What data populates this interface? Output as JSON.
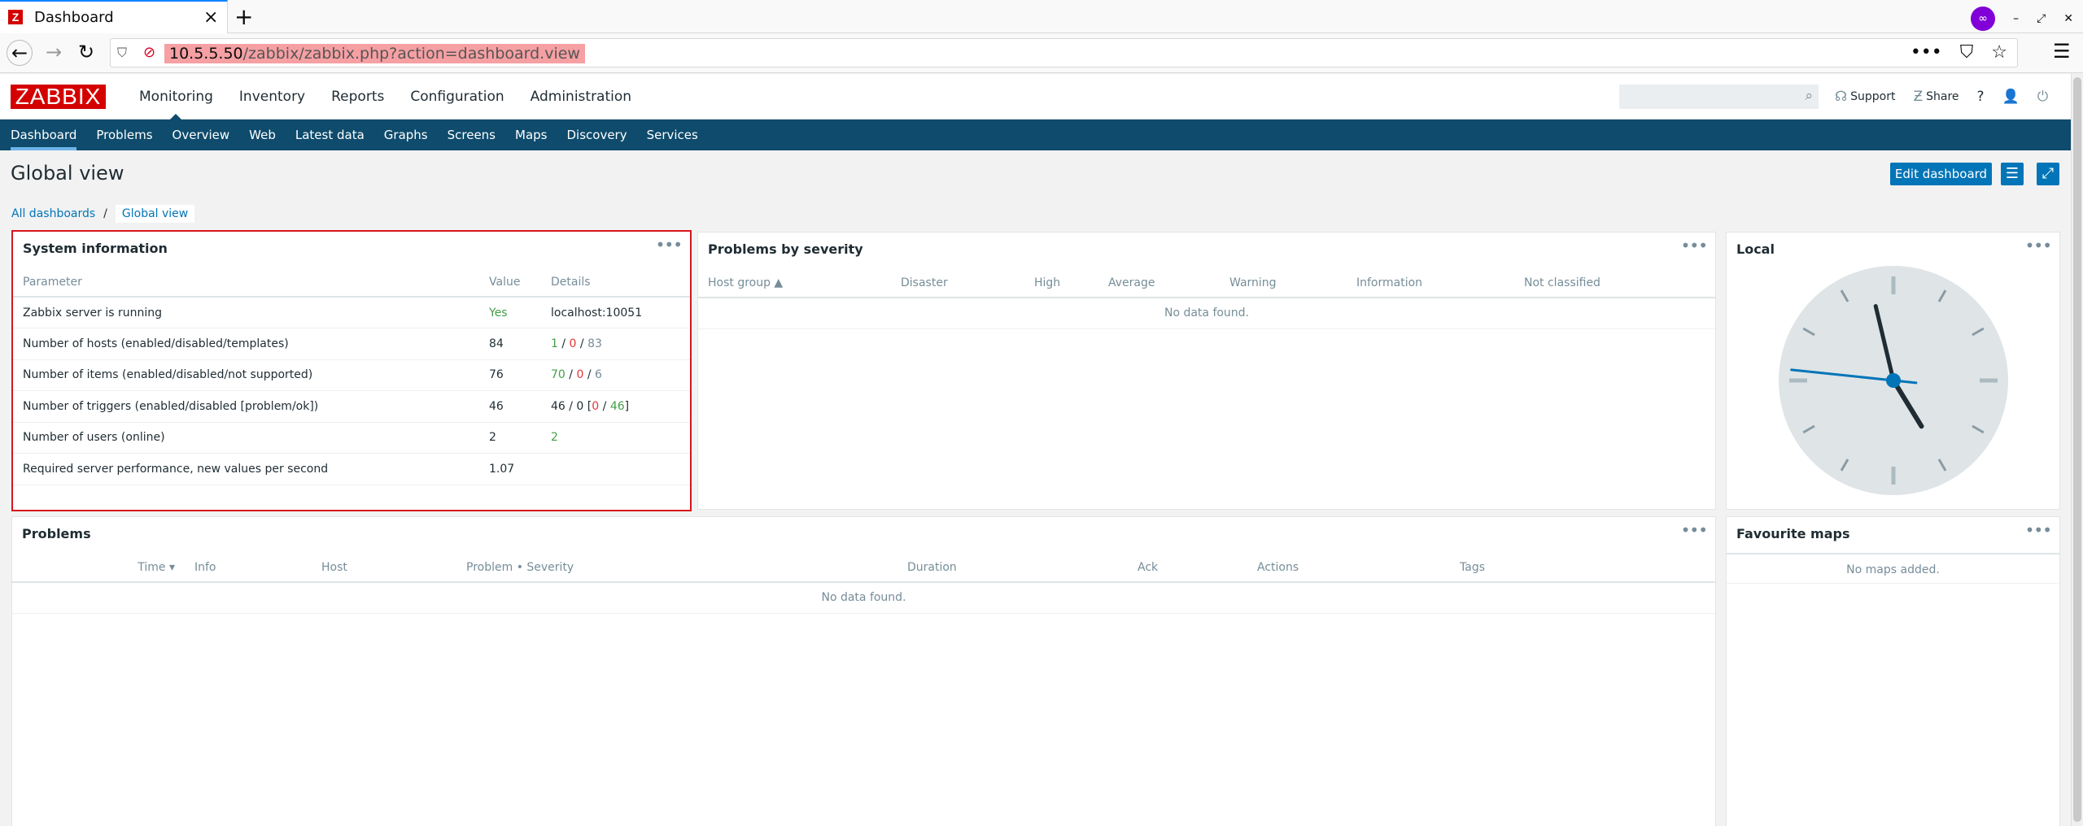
{
  "browser": {
    "tab_title": "Dashboard",
    "tab_favicon": "Z",
    "url_host": "10.5.5.50",
    "url_path": "/zabbix/zabbix.php?action=dashboard.view"
  },
  "header": {
    "logo": "ZABBIX",
    "menu": [
      "Monitoring",
      "Inventory",
      "Reports",
      "Configuration",
      "Administration"
    ],
    "search_placeholder": "",
    "support_label": "Support",
    "share_label": "Share",
    "help_label": "?"
  },
  "submenu": [
    "Dashboard",
    "Problems",
    "Overview",
    "Web",
    "Latest data",
    "Graphs",
    "Screens",
    "Maps",
    "Discovery",
    "Services"
  ],
  "page": {
    "title": "Global view",
    "edit_button": "Edit dashboard",
    "breadcrumb_root": "All dashboards",
    "breadcrumb_sep": "/",
    "breadcrumb_current": "Global view"
  },
  "system_info": {
    "title": "System information",
    "headers": [
      "Parameter",
      "Value",
      "Details"
    ],
    "rows": [
      {
        "param": "Zabbix server is running",
        "value": "Yes",
        "d1": "localhost:10051",
        "d2": "",
        "d3": "",
        "d4": "",
        "d5": "",
        "d6": "",
        "d7": ""
      },
      {
        "param": "Number of hosts (enabled/disabled/templates)",
        "value": "84",
        "d1": "1",
        "d2": " / ",
        "d3": "0",
        "d4": " / ",
        "d5": "83",
        "d6": "",
        "d7": ""
      },
      {
        "param": "Number of items (enabled/disabled/not supported)",
        "value": "76",
        "d1": "70",
        "d2": " / ",
        "d3": "0",
        "d4": " / ",
        "d5": "6",
        "d6": "",
        "d7": ""
      },
      {
        "param": "Number of triggers (enabled/disabled [problem/ok])",
        "value": "46",
        "d1": "46 / 0 [",
        "d2": "",
        "d3": "0",
        "d4": " / ",
        "d5": "46",
        "d6": "]",
        "d7": ""
      },
      {
        "param": "Number of users (online)",
        "value": "2",
        "d1": "",
        "d2": "",
        "d3": "",
        "d4": "",
        "d5": "2",
        "d6": "",
        "d7": ""
      },
      {
        "param": "Required server performance, new values per second",
        "value": "1.07",
        "d1": "",
        "d2": "",
        "d3": "",
        "d4": "",
        "d5": "",
        "d6": "",
        "d7": ""
      }
    ]
  },
  "problems_by_severity": {
    "title": "Problems by severity",
    "headers": [
      "Host group ▲",
      "Disaster",
      "High",
      "Average",
      "Warning",
      "Information",
      "Not classified"
    ],
    "empty": "No data found."
  },
  "clock": {
    "title": "Local",
    "hour": 4,
    "minute": 57,
    "second": 46
  },
  "problems": {
    "title": "Problems",
    "headers": [
      "Time ▾",
      "Info",
      "Host",
      "Problem • Severity",
      "Duration",
      "Ack",
      "Actions",
      "Tags"
    ],
    "empty": "No data found."
  },
  "favourite_maps": {
    "title": "Favourite maps",
    "empty": "No maps added."
  },
  "colors": {
    "brand_red": "#d40000",
    "nav_blue": "#0e4b6c",
    "button_blue": "#0275b8",
    "ok_green": "#429e47",
    "problem_red": "#e33734",
    "highlight": "#d7151b"
  }
}
